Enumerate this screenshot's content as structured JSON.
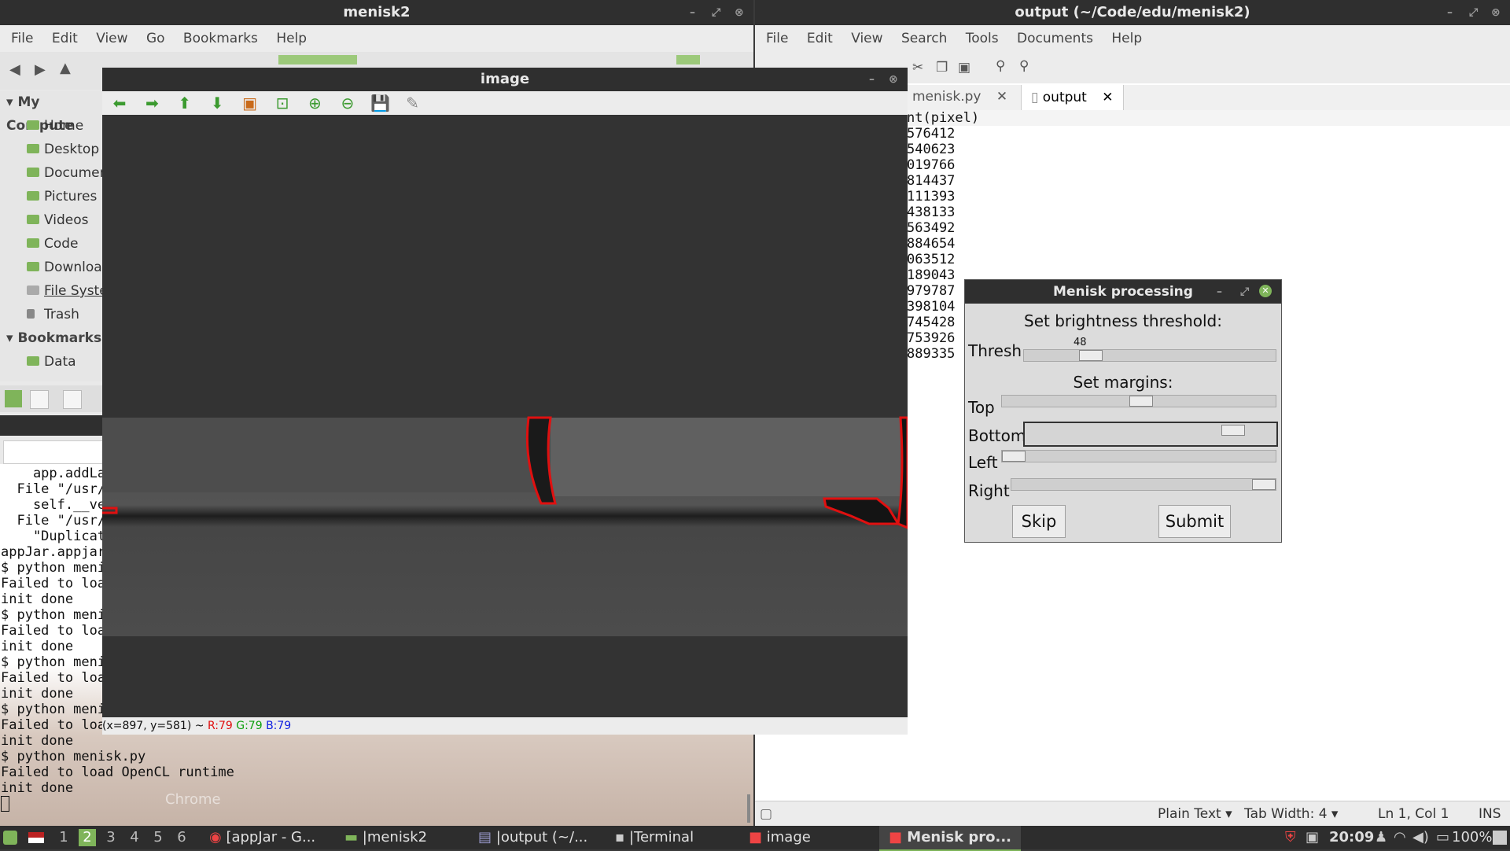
{
  "nemo": {
    "title": "menisk2",
    "menu": [
      "File",
      "Edit",
      "View",
      "Go",
      "Bookmarks",
      "Help"
    ],
    "sidebar": {
      "computer_header": "My Compute",
      "items": [
        "Home",
        "Desktop",
        "Documen",
        "Pictures",
        "Videos",
        "Code",
        "Downloac",
        "File Syster",
        "Trash"
      ],
      "bookmarks_header": "Bookmarks",
      "bookmarks": [
        "Data"
      ]
    }
  },
  "terminal": {
    "lines": [
      "    app.addLa",
      "  File \"/usr/",
      "    self.__ve",
      "  File \"/usr/",
      "    \"Duplicat",
      "appJar.appjar",
      "$ python meni",
      "Failed to loa",
      "init done",
      "$ python meni",
      "Failed to loa",
      "init done",
      "$ python meni",
      "Failed to loa",
      "init done",
      "$ python meni",
      "Failed to loa",
      "init done",
      "$ python menisk.py",
      "Failed to load OpenCL runtime",
      "init done"
    ],
    "desktop_label": "Chrome"
  },
  "gedit": {
    "title": "output (~/Code/edu/menisk2)",
    "menu": [
      "File",
      "Edit",
      "View",
      "Search",
      "Tools",
      "Documents",
      "Help"
    ],
    "tabs": [
      "menisk.py",
      "output"
    ],
    "lines": [
      "nt(pixel)",
      "576412",
      "540623",
      "019766",
      "814437",
      "111393",
      "438133",
      "563492",
      "884654",
      "063512",
      "189043",
      "979787",
      "398104",
      "745428",
      "753926",
      "889335"
    ],
    "status": {
      "lang": "Plain Text",
      "tab_width": "Tab Width: 4",
      "position": "Ln 1, Col 1",
      "mode": "INS"
    }
  },
  "image_window": {
    "title": "image",
    "status_coords": "(x=897, y=581) ~ ",
    "status_r": "R:79",
    "status_g": "G:79",
    "status_b": "B:79"
  },
  "dialog": {
    "title": "Menisk processing",
    "brightness_label": "Set brightness threshold:",
    "thresh_label": "Thresh",
    "thresh_value": "48",
    "margins_label": "Set margins:",
    "top_label": "Top",
    "bottom_label": "Bottom",
    "left_label": "Left",
    "right_label": "Right",
    "skip": "Skip",
    "submit": "Submit"
  },
  "taskbar": {
    "workspaces": [
      "1",
      "2",
      "3",
      "4",
      "5",
      "6"
    ],
    "tasks": [
      "[appJar - G...",
      "|menisk2",
      "|output (~/...",
      "|Terminal",
      "image",
      "Menisk pro..."
    ],
    "clock": "20:09",
    "battery": "100%"
  },
  "colors": {
    "accent": "#7fb45a",
    "contour": "#e01010"
  }
}
